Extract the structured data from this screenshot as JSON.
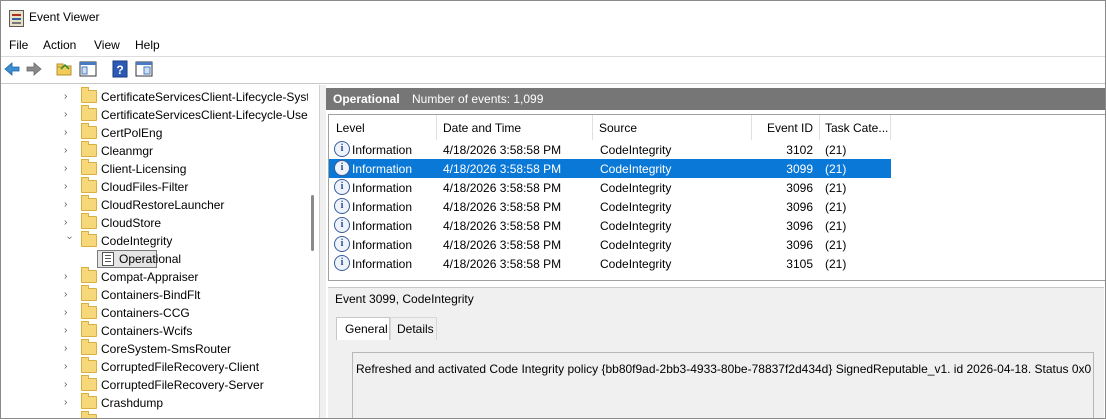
{
  "window": {
    "title": "Event Viewer"
  },
  "menu": {
    "file": "File",
    "action": "Action",
    "view": "View",
    "help": "Help"
  },
  "toolbar": {
    "buttons": [
      "back-arrow-icon",
      "forward-arrow-icon",
      "open-folder-icon",
      "show-hide-console-tree-icon",
      "help-icon",
      "show-hide-action-pane-icon"
    ]
  },
  "tree": {
    "items": [
      {
        "label": "CertificateServicesClient-Lifecycle-Syst"
      },
      {
        "label": "CertificateServicesClient-Lifecycle-Use"
      },
      {
        "label": "CertPolEng"
      },
      {
        "label": "Cleanmgr"
      },
      {
        "label": "Client-Licensing"
      },
      {
        "label": "CloudFiles-Filter"
      },
      {
        "label": "CloudRestoreLauncher"
      },
      {
        "label": "CloudStore"
      },
      {
        "label": "CodeIntegrity"
      },
      {
        "label": "Operational"
      },
      {
        "label": "Compat-Appraiser"
      },
      {
        "label": "Containers-BindFlt"
      },
      {
        "label": "Containers-CCG"
      },
      {
        "label": "Containers-Wcifs"
      },
      {
        "label": "CoreSystem-SmsRouter"
      },
      {
        "label": "CorruptedFileRecovery-Client"
      },
      {
        "label": "CorruptedFileRecovery-Server"
      },
      {
        "label": "Crashdump"
      }
    ]
  },
  "log": {
    "name": "Operational",
    "count_text": "Number of events: 1,099"
  },
  "grid": {
    "columns": [
      "Level",
      "Date and Time",
      "Source",
      "Event ID",
      "Task Cate..."
    ],
    "rows": [
      {
        "level": "Information",
        "datetime": "4/18/2026 3:58:58 PM",
        "source": "CodeIntegrity",
        "event_id": "3102",
        "task": "(21)"
      },
      {
        "level": "Information",
        "datetime": "4/18/2026 3:58:58 PM",
        "source": "CodeIntegrity",
        "event_id": "3099",
        "task": "(21)"
      },
      {
        "level": "Information",
        "datetime": "4/18/2026 3:58:58 PM",
        "source": "CodeIntegrity",
        "event_id": "3096",
        "task": "(21)"
      },
      {
        "level": "Information",
        "datetime": "4/18/2026 3:58:58 PM",
        "source": "CodeIntegrity",
        "event_id": "3096",
        "task": "(21)"
      },
      {
        "level": "Information",
        "datetime": "4/18/2026 3:58:58 PM",
        "source": "CodeIntegrity",
        "event_id": "3096",
        "task": "(21)"
      },
      {
        "level": "Information",
        "datetime": "4/18/2026 3:58:58 PM",
        "source": "CodeIntegrity",
        "event_id": "3096",
        "task": "(21)"
      },
      {
        "level": "Information",
        "datetime": "4/18/2026 3:58:58 PM",
        "source": "CodeIntegrity",
        "event_id": "3105",
        "task": "(21)"
      }
    ]
  },
  "details": {
    "header": "Event 3099, CodeIntegrity",
    "tabs": [
      "General",
      "Details"
    ],
    "message": "Refreshed and activated Code Integrity policy {bb80f9ad-2bb3-4933-80be-78837f2d434d} SignedReputable_v1. id 2026-04-18. Status 0x0"
  }
}
